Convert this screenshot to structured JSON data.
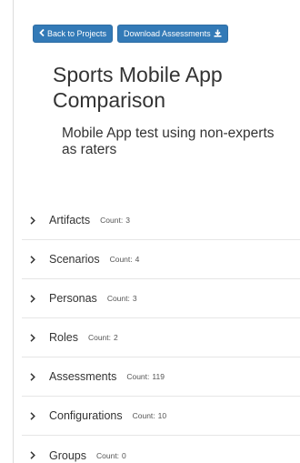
{
  "toolbar": {
    "back_label": "Back to Projects",
    "back_icon": "chevron-left-icon",
    "download_label": "Download Assessments",
    "download_icon": "download-icon",
    "accent_color": "#337ab7"
  },
  "project": {
    "title": "Sports Mobile App Comparison",
    "description": "Mobile App test using non-experts as raters"
  },
  "sections": [
    {
      "label": "Artifacts",
      "count_label": "Count:",
      "count": "3"
    },
    {
      "label": "Scenarios",
      "count_label": "Count:",
      "count": "4"
    },
    {
      "label": "Personas",
      "count_label": "Count:",
      "count": "3"
    },
    {
      "label": "Roles",
      "count_label": "Count:",
      "count": "2"
    },
    {
      "label": "Assessments",
      "count_label": "Count:",
      "count": "119"
    },
    {
      "label": "Configurations",
      "count_label": "Count:",
      "count": "10"
    },
    {
      "label": "Groups",
      "count_label": "Count:",
      "count": "0"
    }
  ]
}
